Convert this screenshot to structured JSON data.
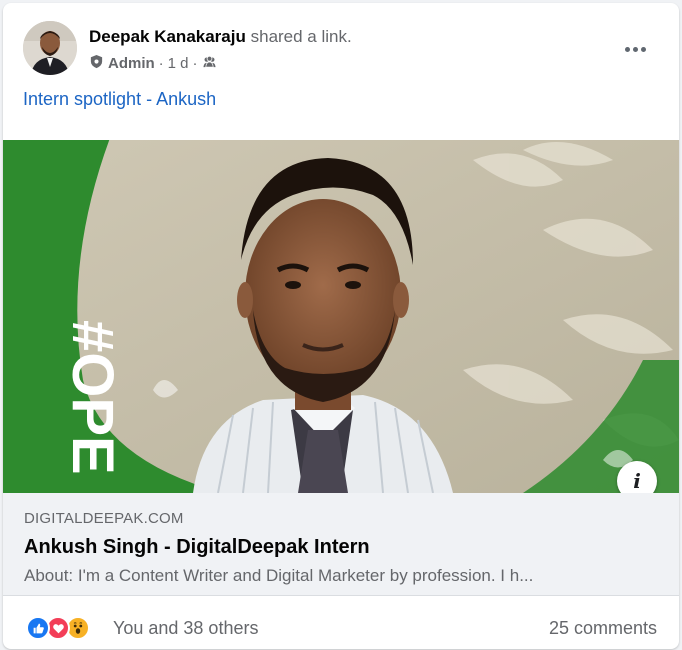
{
  "post": {
    "author": "Deepak Kanakaraju",
    "action": "shared a link.",
    "role": "Admin",
    "time": "1 d",
    "audience_icon": "group-audience-icon",
    "text": "Intern spotlight - Ankush"
  },
  "link_preview": {
    "domain": "DIGITALDEEPAK.COM",
    "title": "Ankush Singh - DigitalDeepak Intern",
    "description": "About: I'm a Content Writer and Digital Marketer by profession. I h...",
    "frame_text": "#OPE",
    "frame_color": "#2e8b2e"
  },
  "engagement": {
    "reactions": [
      "like-icon",
      "love-icon",
      "wow-icon"
    ],
    "reaction_text": "You and 38 others",
    "comments": "25 comments"
  },
  "colors": {
    "link_blue": "#1c65c4",
    "secondary_text": "#65676b",
    "like": "#1877f2",
    "love": "#f33e58",
    "wow": "#f7b125"
  }
}
